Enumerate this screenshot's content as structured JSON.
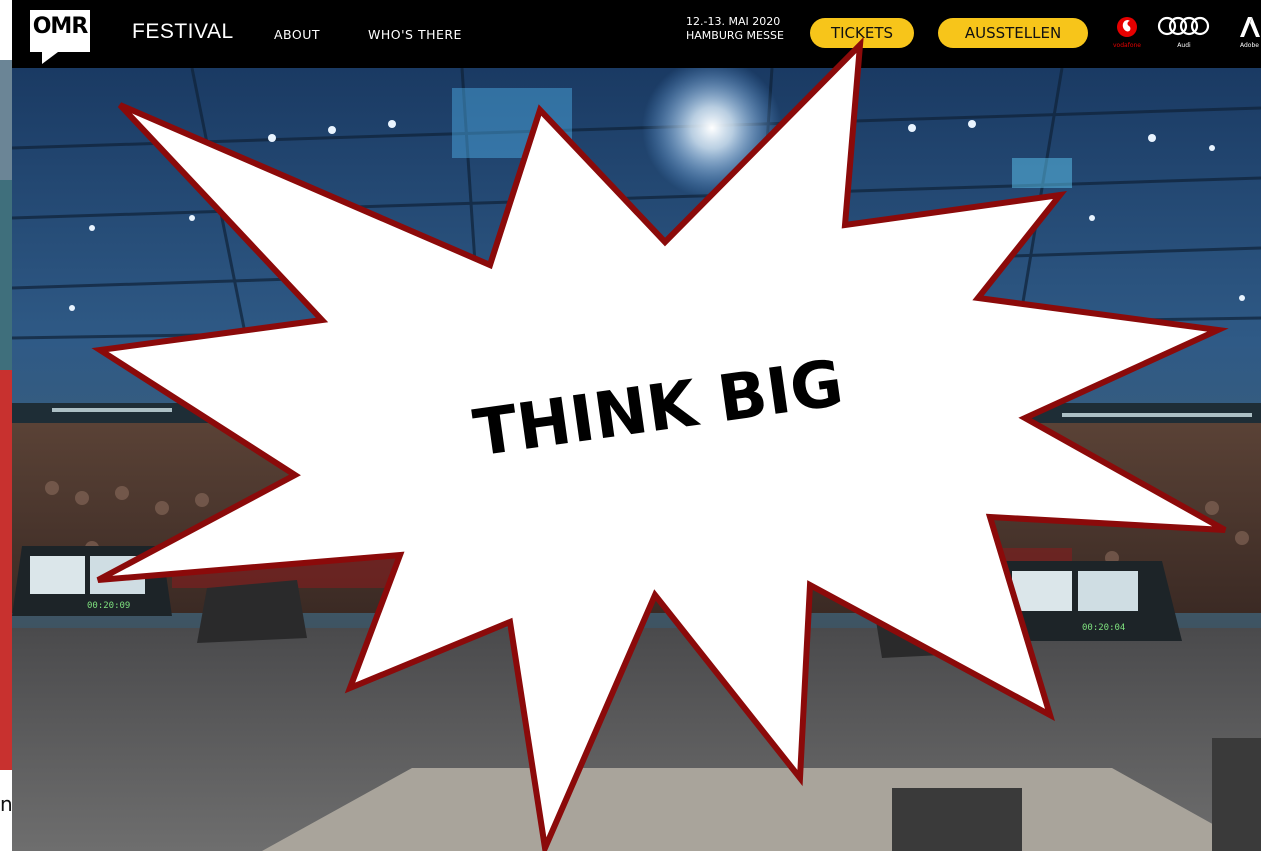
{
  "nav": {
    "logo_text": "OMR",
    "festival_label": "FESTIVAL",
    "links": [
      {
        "label": "ABOUT"
      },
      {
        "label": "WHO'S THERE"
      }
    ],
    "event_date": "12.-13. MAI 2020",
    "event_location": "HAMBURG MESSE",
    "tickets_label": "TICKETS",
    "aussteller_label": "AUSSTELLEN",
    "sponsors": [
      {
        "name": "vodafone",
        "icon": "vodafone-logo-icon"
      },
      {
        "name": "Audi",
        "icon": "audi-logo-icon"
      },
      {
        "name": "Adobe",
        "icon": "adobe-logo-icon"
      }
    ]
  },
  "hero": {
    "description_icon": "conference-hall-photo",
    "screen_left_text": "00:20:09",
    "screen_right_text": "00:20:04"
  },
  "callout": {
    "text": "THINK BIG"
  },
  "background_page": {
    "visible_text": "n"
  },
  "colors": {
    "nav_background": "#000000",
    "pill_background": "#f7c51a",
    "burst_fill": "#ffffff",
    "burst_stroke": "#8b0a0a"
  }
}
